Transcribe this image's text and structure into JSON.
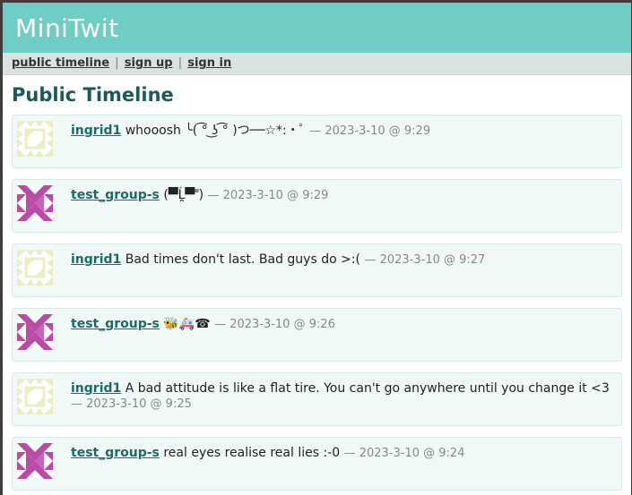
{
  "app": {
    "title": "MiniTwit"
  },
  "nav": {
    "public_timeline": "public timeline",
    "sign_up": "sign up",
    "sign_in": "sign in",
    "separator": "|"
  },
  "page": {
    "heading": "Public Timeline"
  },
  "messages": [
    {
      "user": "ingrid1",
      "text": "whooosh ╰( ͡° ͜ʖ ͡° )つ──☆*:・ﾟ",
      "timestamp": "— 2023-3-10 @ 9:29",
      "avatar": "ingrid"
    },
    {
      "user": "test_group-s",
      "text": "(▀̿Ĺ̯▀̿ ̿)",
      "timestamp": "— 2023-3-10 @ 9:29",
      "avatar": "test"
    },
    {
      "user": "ingrid1",
      "text": "Bad times don't last. Bad guys do >:(",
      "timestamp": "— 2023-3-10 @ 9:27",
      "avatar": "ingrid"
    },
    {
      "user": "test_group-s",
      "text": "🐝🚑☎",
      "timestamp": "— 2023-3-10 @ 9:26",
      "avatar": "test"
    },
    {
      "user": "ingrid1",
      "text": "A bad attitude is like a flat tire. You can't go anywhere until you change it <3",
      "timestamp": "— 2023-3-10 @ 9:25",
      "avatar": "ingrid"
    },
    {
      "user": "test_group-s",
      "text": "real eyes realise real lies :-0",
      "timestamp": "— 2023-3-10 @ 9:24",
      "avatar": "test"
    }
  ],
  "colors": {
    "header": "#70cdc4",
    "avatar_ingrid": "#e9efc3",
    "avatar_test": "#b94aa8"
  }
}
